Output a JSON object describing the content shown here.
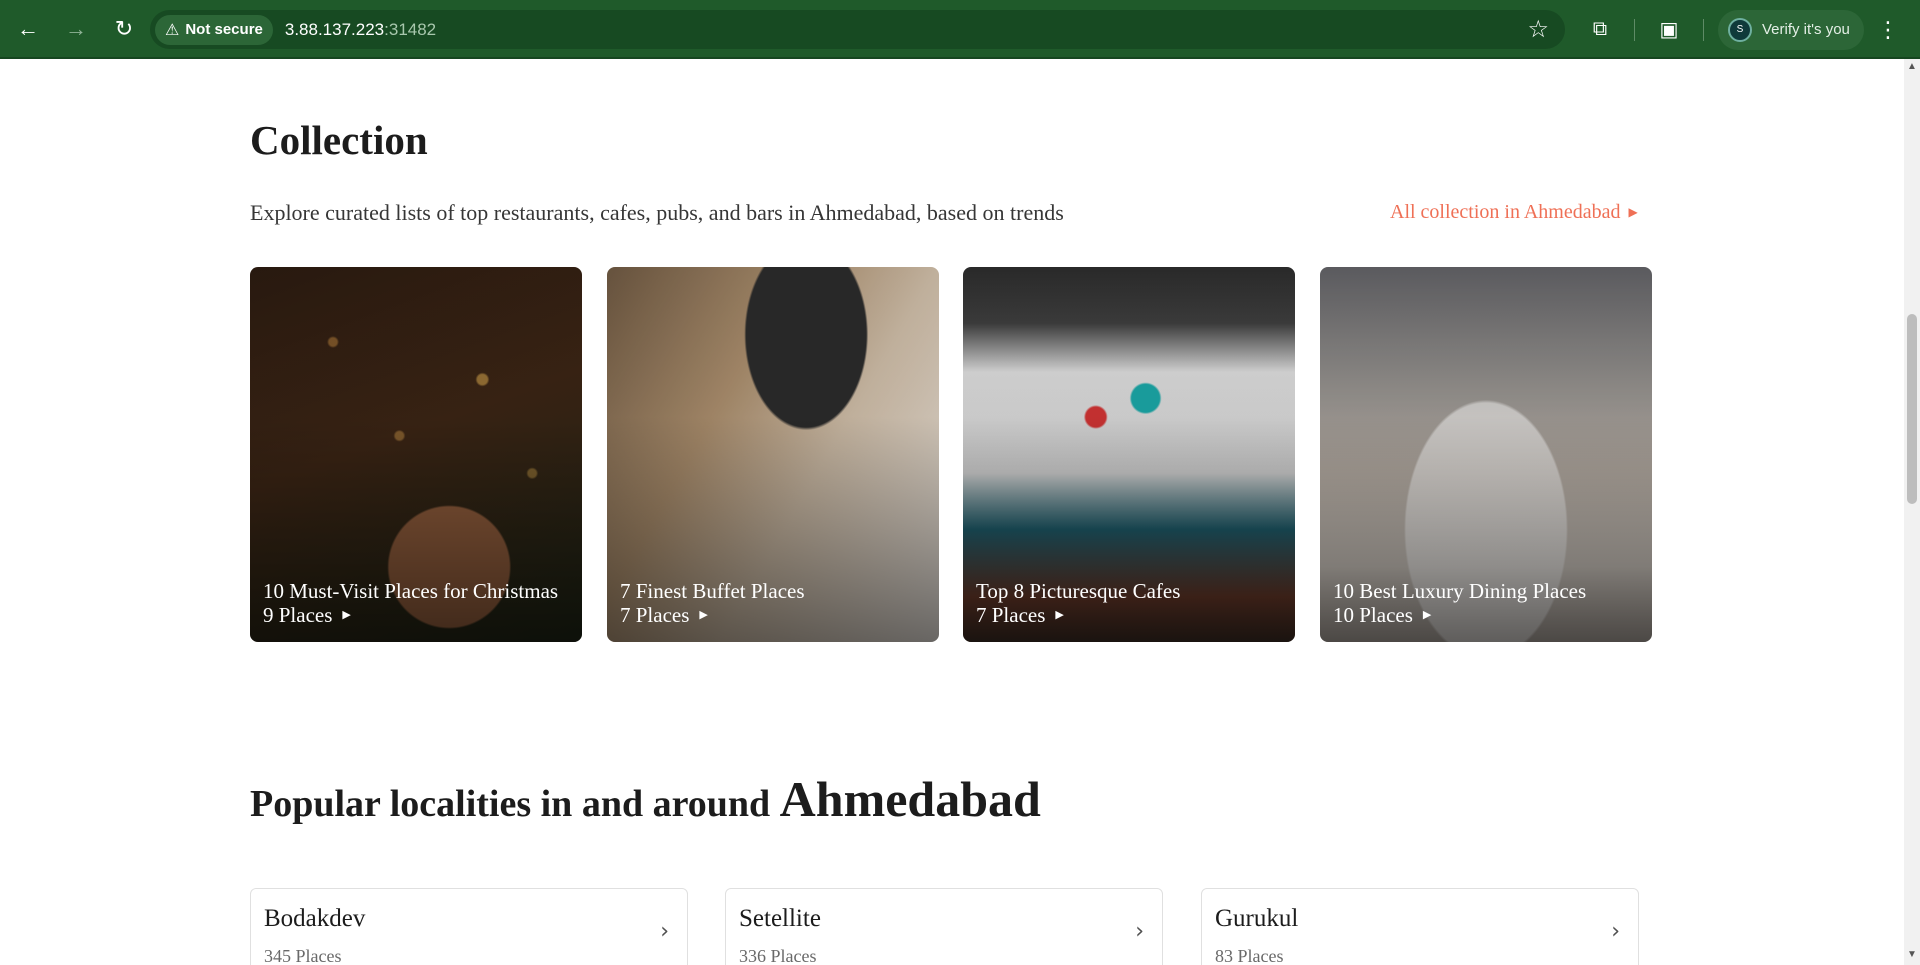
{
  "browser": {
    "security_label": "Not secure",
    "url_host": "3.88.137.223",
    "url_port": ":31482",
    "profile_label": "Verify it's you",
    "avatar_letter": "S"
  },
  "collection": {
    "title": "Collection",
    "description": "Explore curated lists of top restaurants, cafes, pubs, and bars in Ahmedabad, based on trends",
    "all_link": "All collection in Ahmedabad",
    "cards": [
      {
        "title": "10 Must-Visit Places for Christmas",
        "count": "9 Places"
      },
      {
        "title": "7 Finest Buffet Places",
        "count": "7 Places"
      },
      {
        "title": "Top 8 Picturesque Cafes",
        "count": "7 Places"
      },
      {
        "title": "10 Best Luxury Dining Places",
        "count": "10 Places"
      }
    ]
  },
  "localities": {
    "title_prefix": "Popular localities in and around",
    "city": "Ahmedabad",
    "items": [
      {
        "name": "Bodakdev",
        "count": "345 Places"
      },
      {
        "name": "Setellite",
        "count": "336 Places"
      },
      {
        "name": "Gurukul",
        "count": "83 Places"
      }
    ]
  },
  "colors": {
    "chrome_bg": "#1f5a2a",
    "accent_link": "#ef7056"
  }
}
